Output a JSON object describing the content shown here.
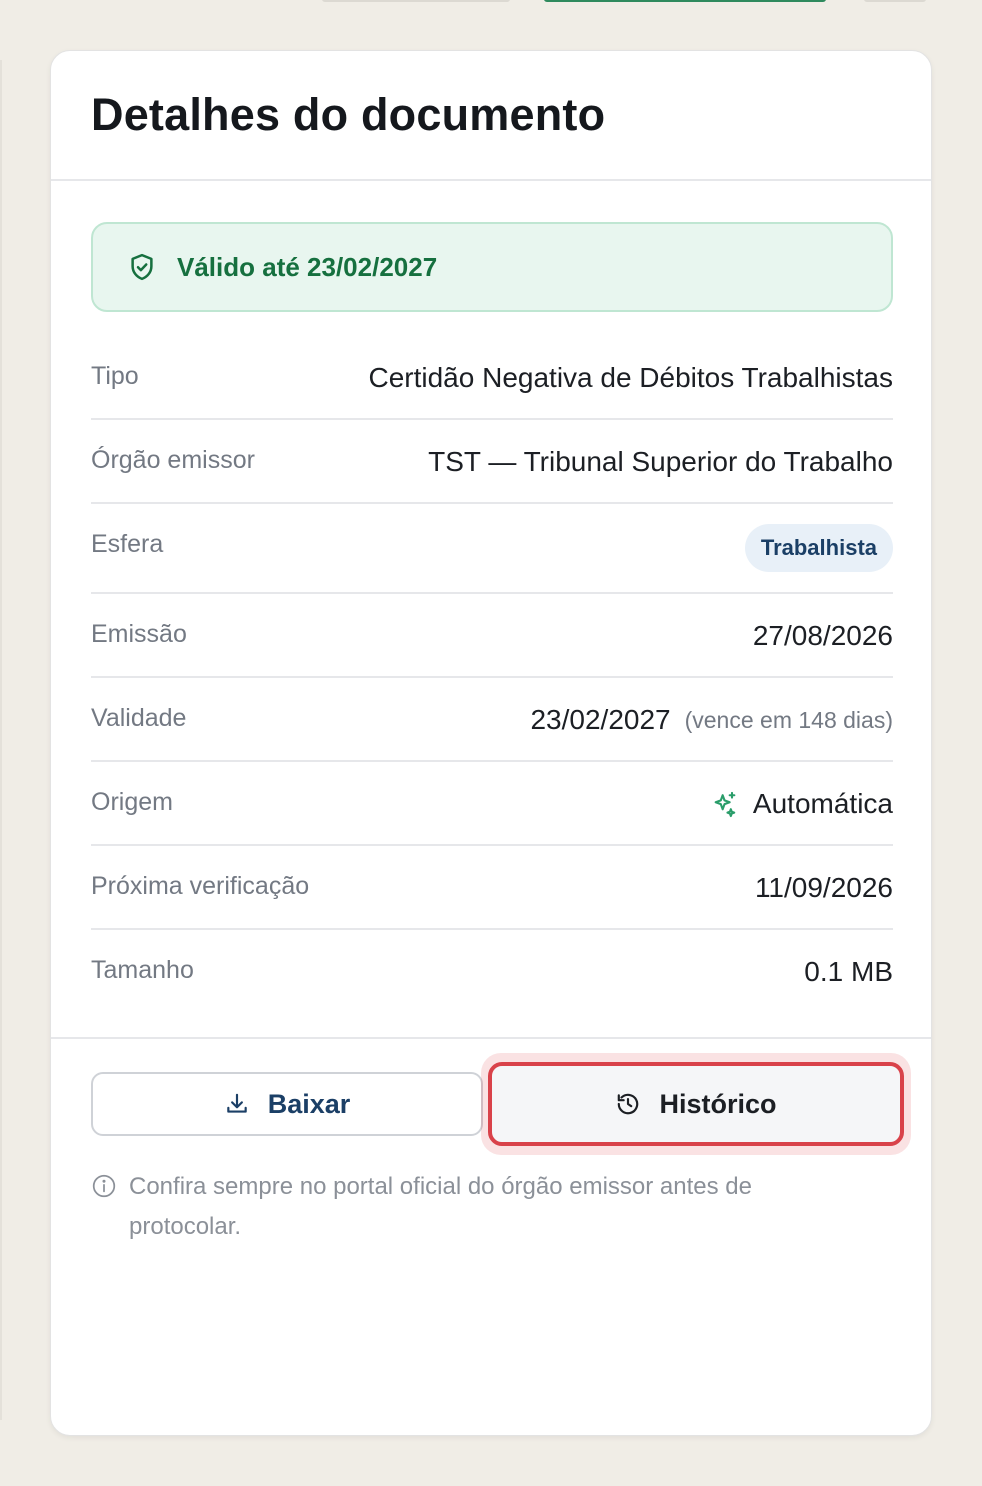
{
  "card": {
    "title": "Detalhes do documento"
  },
  "validity": {
    "text": "Válido até 23/02/2027",
    "icon": "shield-check-icon",
    "color": "#16703f"
  },
  "details": {
    "tipo": {
      "label": "Tipo",
      "value": "Certidão Negativa de Débitos Trabalhistas"
    },
    "orgao": {
      "label": "Órgão emissor",
      "value": "TST — Tribunal Superior do Trabalho"
    },
    "esfera": {
      "label": "Esfera",
      "value": "Trabalhista"
    },
    "emissao": {
      "label": "Emissão",
      "value": "27/08/2026"
    },
    "validade": {
      "label": "Validade",
      "value": "23/02/2027",
      "note": "(vence em 148 dias)"
    },
    "origem": {
      "label": "Origem",
      "value": "Automática",
      "icon": "sparkle-icon"
    },
    "proxima": {
      "label": "Próxima verificação",
      "value": "11/09/2026"
    },
    "tamanho": {
      "label": "Tamanho",
      "value": "0.1 MB"
    }
  },
  "actions": {
    "download_label": "Baixar",
    "download_icon": "download-icon",
    "history_label": "Histórico",
    "history_icon": "history-icon"
  },
  "footer_note": {
    "icon": "info-icon",
    "text": "Confira sempre no portal oficial do órgão emissor antes de protocolar."
  },
  "colors": {
    "accent_green": "#16703f",
    "highlight_red": "#d9424a",
    "navy": "#1b3f66"
  }
}
